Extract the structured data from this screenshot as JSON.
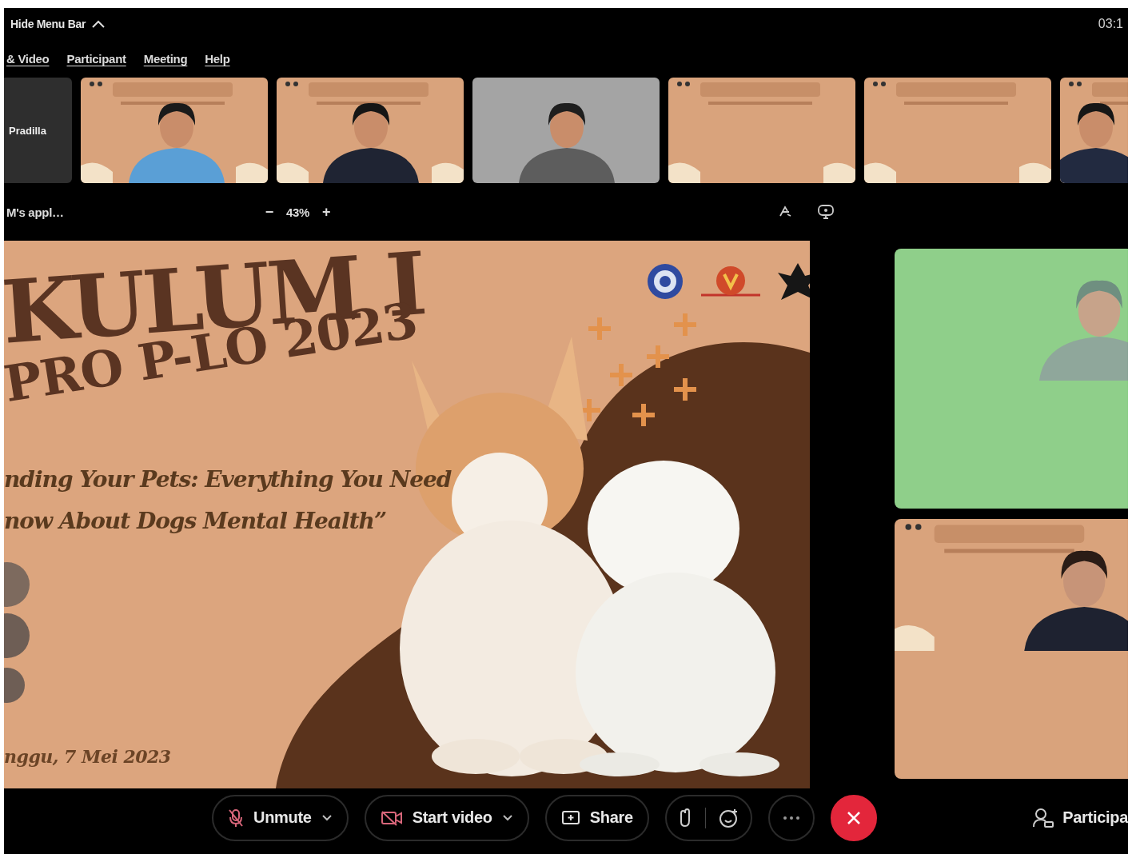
{
  "top_bar": {
    "menu_toggle": "Hide Menu Bar",
    "timer": "03:1"
  },
  "menu": [
    {
      "label": "& Video"
    },
    {
      "label": "Participant"
    },
    {
      "label": "Meeting"
    },
    {
      "label": "Help"
    }
  ],
  "video_strip": [
    {
      "kind": "name",
      "name": "Pradilla"
    },
    {
      "kind": "picture"
    },
    {
      "kind": "picture"
    },
    {
      "kind": "picture"
    },
    {
      "kind": "picture"
    },
    {
      "kind": "picture"
    },
    {
      "kind": "picture"
    }
  ],
  "shared_content": {
    "title": "M's appl…",
    "zoom_out": "−",
    "zoom": "43%",
    "zoom_in": "+"
  },
  "slide": {
    "title": "KULUM I",
    "subtitle": "PRO P-LO 2023",
    "tagline": [
      "nding Your Pets: Everything You Need",
      "now About Dogs Mental Health”"
    ],
    "date": "nggu, 7 Mei 2023"
  },
  "toolbar": {
    "buttons": [
      {
        "kind": "mic",
        "label": "Unmute",
        "menu": true
      },
      {
        "kind": "video",
        "label": "Start video",
        "menu": true
      },
      {
        "kind": "share",
        "label": "Share",
        "menu": false
      },
      {
        "kind": "hand-reaction",
        "menu": false
      },
      {
        "kind": "more",
        "menu": false
      },
      {
        "kind": "leave",
        "menu": false
      }
    ],
    "participants": "Participa"
  }
}
